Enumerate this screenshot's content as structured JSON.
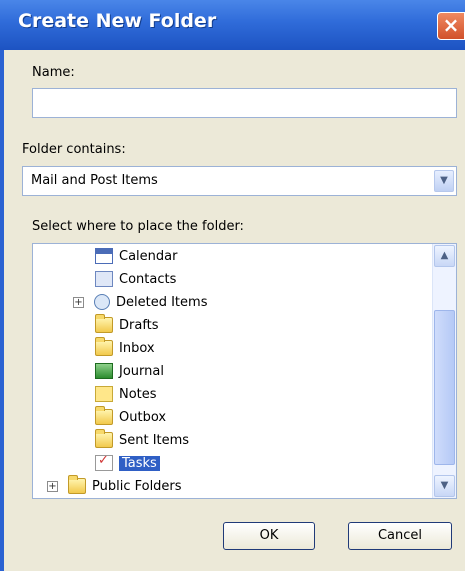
{
  "dialog": {
    "title": "Create New Folder",
    "close_icon": "close-icon",
    "name_label": "Name:",
    "name_value": "",
    "folder_contains_label": "Folder contains:",
    "folder_contains_value": "Mail and Post Items",
    "select_location_label": "Select where to place the folder:",
    "tree": [
      {
        "label": "Calendar",
        "icon": "calendar-icon"
      },
      {
        "label": "Contacts",
        "icon": "contacts-icon"
      },
      {
        "label": "Deleted Items",
        "icon": "deleted-items-icon",
        "expander": "+"
      },
      {
        "label": "Drafts",
        "icon": "folder-icon"
      },
      {
        "label": "Inbox",
        "icon": "folder-icon"
      },
      {
        "label": "Journal",
        "icon": "journal-icon"
      },
      {
        "label": "Notes",
        "icon": "notes-icon"
      },
      {
        "label": "Outbox",
        "icon": "folder-icon"
      },
      {
        "label": "Sent Items",
        "icon": "folder-icon"
      },
      {
        "label": "Tasks",
        "icon": "tasks-icon",
        "selected": true
      },
      {
        "label": "Public Folders",
        "icon": "public-folders-icon",
        "expander": "+"
      }
    ],
    "ok_label": "OK",
    "cancel_label": "Cancel"
  }
}
